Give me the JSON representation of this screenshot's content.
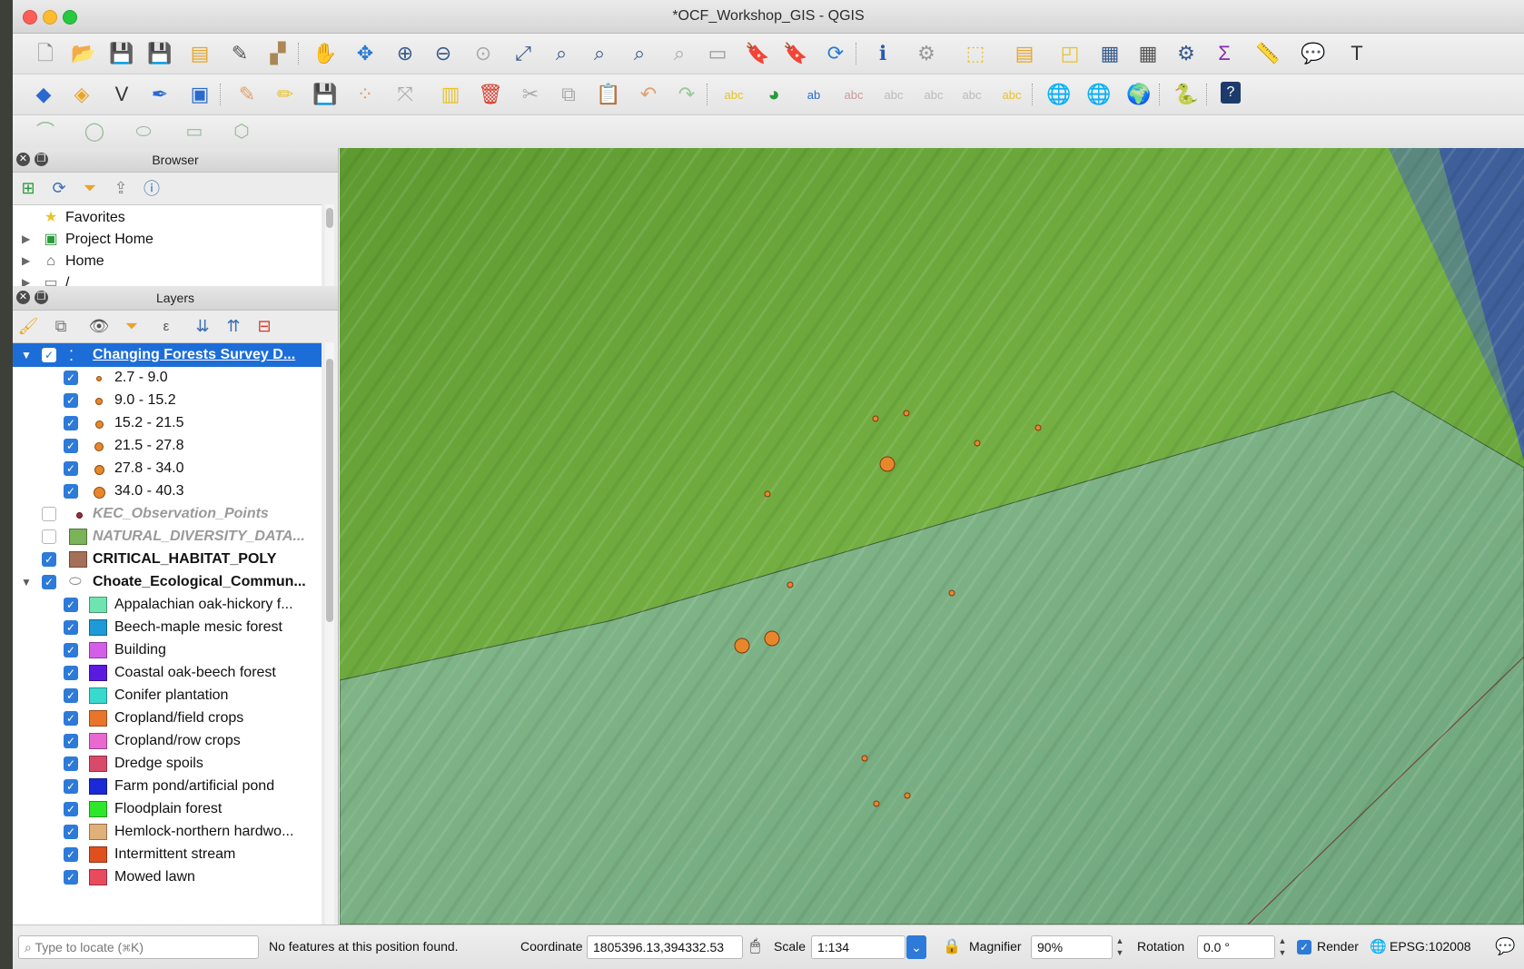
{
  "window": {
    "title": "*OCF_Workshop_GIS - QGIS"
  },
  "browser": {
    "title": "Browser",
    "items": [
      {
        "label": "Favorites",
        "icon": "star-icon",
        "expandable": false
      },
      {
        "label": "Project Home",
        "icon": "project-folder-icon",
        "expandable": true
      },
      {
        "label": "Home",
        "icon": "home-folder-icon",
        "expandable": true
      },
      {
        "label": "/",
        "icon": "folder-icon",
        "expandable": true
      }
    ]
  },
  "layers": {
    "title": "Layers",
    "items": [
      {
        "label": "Changing Forests Survey D...",
        "checked": true,
        "expanded": true,
        "selected": true,
        "level": 0,
        "symbol": "points"
      },
      {
        "label": "2.7 - 9.0",
        "checked": true,
        "level": 1,
        "symbol": "dot",
        "size": 4
      },
      {
        "label": "9.0 - 15.2",
        "checked": true,
        "level": 1,
        "symbol": "dot",
        "size": 6
      },
      {
        "label": "15.2 - 21.5",
        "checked": true,
        "level": 1,
        "symbol": "dot",
        "size": 7
      },
      {
        "label": "21.5 - 27.8",
        "checked": true,
        "level": 1,
        "symbol": "dot",
        "size": 8
      },
      {
        "label": "27.8 - 34.0",
        "checked": true,
        "level": 1,
        "symbol": "dot",
        "size": 9
      },
      {
        "label": "34.0 - 40.3",
        "checked": true,
        "level": 1,
        "symbol": "dot",
        "size": 11
      },
      {
        "label": "KEC_Observation_Points",
        "checked": false,
        "level": 0,
        "symbol": "dot-red",
        "style": "dim"
      },
      {
        "label": "NATURAL_DIVERSITY_DATA...",
        "checked": false,
        "level": 0,
        "symbol": "swatch",
        "color": "#7ab35a",
        "style": "dim"
      },
      {
        "label": "CRITICAL_HABITAT_POLY",
        "checked": true,
        "level": 0,
        "symbol": "swatch",
        "color": "#a5705a",
        "style": "bold"
      },
      {
        "label": "Choate_Ecological_Commun...",
        "checked": true,
        "expanded": true,
        "level": 0,
        "symbol": "polygon",
        "style": "bold"
      },
      {
        "label": "Appalachian oak-hickory f...",
        "checked": true,
        "level": 1,
        "symbol": "swatch",
        "color": "#6fe3b0"
      },
      {
        "label": "Beech-maple mesic forest",
        "checked": true,
        "level": 1,
        "symbol": "swatch",
        "color": "#1e9ad6"
      },
      {
        "label": "Building",
        "checked": true,
        "level": 1,
        "symbol": "swatch",
        "color": "#d35fe8"
      },
      {
        "label": "Coastal oak-beech forest",
        "checked": true,
        "level": 1,
        "symbol": "swatch",
        "color": "#5b1ae0"
      },
      {
        "label": "Conifer plantation",
        "checked": true,
        "level": 1,
        "symbol": "swatch",
        "color": "#3ad9d0"
      },
      {
        "label": "Cropland/field crops",
        "checked": true,
        "level": 1,
        "symbol": "swatch",
        "color": "#e8752a"
      },
      {
        "label": "Cropland/row crops",
        "checked": true,
        "level": 1,
        "symbol": "swatch",
        "color": "#e86ad0"
      },
      {
        "label": "Dredge spoils",
        "checked": true,
        "level": 1,
        "symbol": "swatch",
        "color": "#d94a6a"
      },
      {
        "label": "Farm pond/artificial pond",
        "checked": true,
        "level": 1,
        "symbol": "swatch",
        "color": "#1a2ad6"
      },
      {
        "label": "Floodplain forest",
        "checked": true,
        "level": 1,
        "symbol": "swatch",
        "color": "#2ee62a"
      },
      {
        "label": "Hemlock-northern hardwo...",
        "checked": true,
        "level": 1,
        "symbol": "swatch",
        "color": "#e0b078"
      },
      {
        "label": "Intermittent stream",
        "checked": true,
        "level": 1,
        "symbol": "swatch",
        "color": "#e0501e"
      },
      {
        "label": "Mowed lawn",
        "checked": true,
        "level": 1,
        "symbol": "swatch",
        "color": "#e84a5e"
      }
    ]
  },
  "status": {
    "search_placeholder": "Type to locate (⌘K)",
    "message": "No features at this position found.",
    "coordinate_label": "Coordinate",
    "coordinate_value": "1805396.13,394332.53",
    "scale_label": "Scale",
    "scale_value": "1:134",
    "magnifier_label": "Magnifier",
    "magnifier_value": "90%",
    "rotation_label": "Rotation",
    "rotation_value": "0.0 °",
    "render_label": "Render",
    "render_checked": true,
    "crs": "EPSG:102008"
  },
  "colors": {
    "selection": "#1c6dd8",
    "point_fill": "#e8872a",
    "forest_green": "#6ea83e",
    "community_teal": "#7eb58a",
    "water_blue": "#3e5f9a"
  }
}
